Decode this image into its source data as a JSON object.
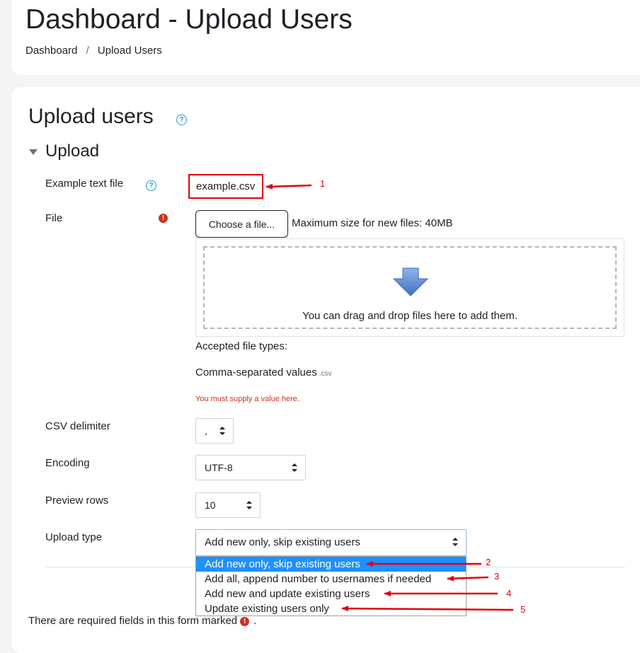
{
  "header": {
    "title": "Dashboard - Upload Users",
    "breadcrumb": [
      "Dashboard",
      "Upload Users"
    ],
    "breadcrumb_separator": "/"
  },
  "form": {
    "heading": "Upload users",
    "help_glyph": "?",
    "section_legend": "Upload",
    "example_label": "Example text file",
    "example_link": "example.csv",
    "file_label": "File",
    "required_glyph": "!",
    "choose_button": "Choose a file...",
    "max_size": "Maximum size for new files: 40MB",
    "drop_text": "You can drag and drop files here to add them.",
    "accepted_heading": "Accepted file types:",
    "accepted_type": "Comma-separated values",
    "accepted_ext": ".csv",
    "error_text": "You must supply a value here.",
    "csv_label": "CSV delimiter",
    "csv_value": ",",
    "encoding_label": "Encoding",
    "encoding_value": "UTF-8",
    "preview_label": "Preview rows",
    "preview_value": "10",
    "uploadtype_label": "Upload type",
    "uploadtype_value": "Add new only, skip existing users",
    "uploadtype_options": [
      "Add new only, skip existing users",
      "Add all, append number to usernames if needed",
      "Add new and update existing users",
      "Update existing users only"
    ],
    "footer_prefix": "There are required fields in this form marked",
    "footer_suffix": "."
  },
  "annotations": [
    "1",
    "2",
    "3",
    "4",
    "5"
  ],
  "icons": {
    "help": "help-icon",
    "required": "required-icon",
    "collapse": "collapse-triangle-icon",
    "drop": "down-arrow-icon",
    "select_caret": "updown-caret-icon"
  },
  "colors": {
    "accent": "#1f9ad3",
    "required": "#ca3120",
    "annotation": "#e3000f",
    "selected_option": "#1e90ff"
  }
}
